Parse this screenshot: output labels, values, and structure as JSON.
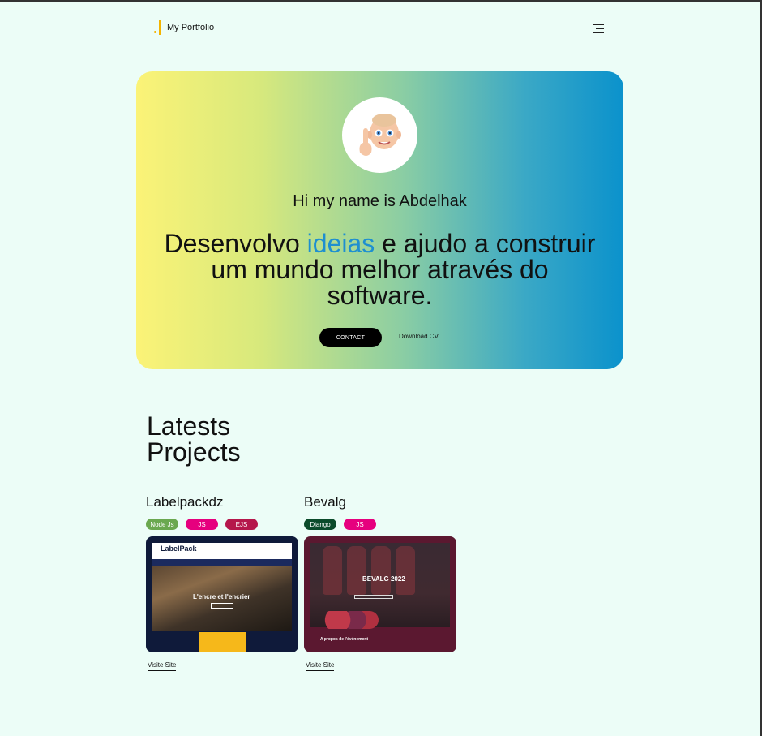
{
  "header": {
    "brand": "My Portfolio"
  },
  "hero": {
    "greeting": "Hi my name is Abdelhak",
    "title_pre": "Desenvolvo ",
    "title_highlight": "ideias",
    "title_post": " e ajudo a construir um mundo melhor através do software.",
    "contact_label": "CONTACT",
    "cv_label": "Download CV"
  },
  "projects_section": {
    "title_line1": "Latests",
    "title_line2": "Projects"
  },
  "projects": [
    {
      "name": "Labelpackdz",
      "tags": [
        {
          "label": "Node Js",
          "color": "#6aa84f"
        },
        {
          "label": "JS",
          "color": "#e6007e"
        },
        {
          "label": "EJS",
          "color": "#b5174b"
        }
      ],
      "thumb_logo": "LabelPack",
      "thumb_headline": "L'encre et l'encrier",
      "visit_label": "Visite Site"
    },
    {
      "name": "Bevalg",
      "tags": [
        {
          "label": "Django",
          "color": "#0b4b2b"
        },
        {
          "label": "JS",
          "color": "#e6007e"
        }
      ],
      "thumb_brand": "BEVALG",
      "thumb_year": "2022",
      "thumb_section": "A propos de l'événement",
      "visit_label": "Visite Site"
    }
  ],
  "colors": {
    "background": "#ecfdf7",
    "accent_brand": "#f4b400",
    "highlight": "#1e8fd0"
  }
}
